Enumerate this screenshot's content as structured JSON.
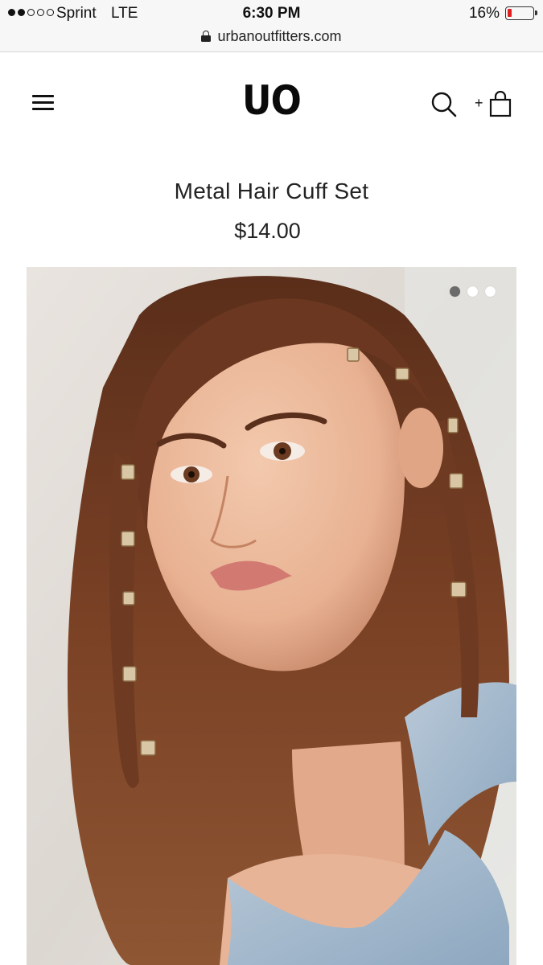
{
  "status_bar": {
    "carrier": "Sprint",
    "network": "LTE",
    "time": "6:30 PM",
    "battery_percent": "16%",
    "battery_level": 0.16,
    "signal_bars": 2,
    "signal_total": 5
  },
  "address_bar": {
    "url": "urbanoutfitters.com",
    "secure": true
  },
  "header": {
    "logo_text": "UO",
    "menu_icon": "hamburger-menu-icon",
    "search_icon": "search-icon",
    "cart_icon": "shopping-bag-icon",
    "cart_plus": "+"
  },
  "product": {
    "title": "Metal Hair Cuff Set",
    "price": "$14.00",
    "image_alt": "Model with metal hair cuffs on braids",
    "carousel": {
      "total": 3,
      "active_index": 0
    }
  },
  "colors": {
    "accent_battery_low": "#e02020",
    "dot_active": "#6b6b6b",
    "dot_inactive": "#ffffff"
  }
}
